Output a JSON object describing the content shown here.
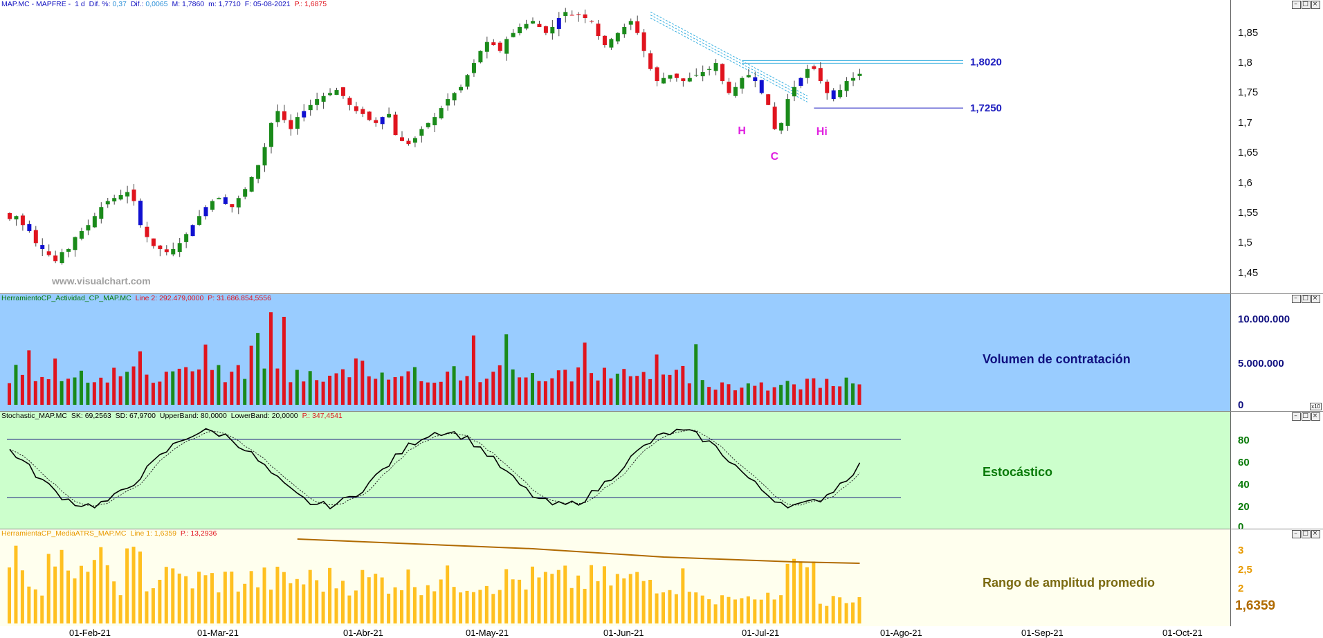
{
  "price_panel": {
    "header": {
      "symbol": "MAP.MC - MAPFRE -",
      "timeframe": "1 d",
      "dif_pct_label": "Dif. %:",
      "dif_pct_value": "0,37",
      "dif_label": "Dif.:",
      "dif_value": "0,0065",
      "max_label": "M: 1,7860",
      "min_label": "m: 1,7710",
      "date_label": "F: 05-08-2021",
      "p_label": "P.: 1,6875"
    },
    "watermark": "www.visualchart.com",
    "levels": [
      {
        "label": "1,8020",
        "value": 1.802
      },
      {
        "label": "1,7250",
        "value": 1.725
      }
    ],
    "pattern_labels": [
      "H",
      "C",
      "Hi"
    ],
    "yticks": [
      "1,85",
      "1,8",
      "1,75",
      "1,7",
      "1,65",
      "1,6",
      "1,55",
      "1,5",
      "1,45"
    ],
    "ytick_values": [
      1.85,
      1.8,
      1.75,
      1.7,
      1.65,
      1.6,
      1.55,
      1.5,
      1.45
    ],
    "colors": {
      "up": "#1a8a1a",
      "down": "#e0141e",
      "inside": "#1010d0",
      "trendline": "#3ab0e0",
      "level": "#2020c0"
    }
  },
  "volume_panel": {
    "header_name": "HerramientoCP_Actividad_CP_MAP.MC",
    "header_line": "Line 2: 292.479,0000",
    "header_p": "P: 31.686.854,5556",
    "title": "Volumen de contratación",
    "yticks": [
      "10.000.000",
      "5.000.000",
      "0"
    ],
    "scale_badge": "x10",
    "background": "#99ccff"
  },
  "stoch_panel": {
    "header_name": "Stochastic_MAP.MC",
    "header_sk": "SK: 69,2563",
    "header_sd": "SD: 67,9700",
    "header_upper": "UpperBand: 80,0000",
    "header_lower": "LowerBand: 20,0000",
    "header_p": "P.: 347,4541",
    "title": "Estocástico",
    "yticks": [
      "80",
      "60",
      "40",
      "20",
      "0"
    ],
    "background": "#ccffcc"
  },
  "atr_panel": {
    "header_name": "HerramientaCP_MediaATRS_MAP.MC",
    "header_line": "Line 1: 1,6359",
    "header_p": "P.: 13,2936",
    "title": "Rango de amplitud promedio",
    "yticks": [
      "3",
      "2,5",
      "2"
    ],
    "current_value": "1,6359",
    "background": "#ffffee"
  },
  "xaxis": {
    "labels": [
      "01-Feb-21",
      "01-Mar-21",
      "01-Abr-21",
      "01-May-21",
      "01-Jun-21",
      "01-Jul-21",
      "01-Ago-21",
      "01-Sep-21",
      "01-Oct-21"
    ]
  },
  "chart_data": {
    "type": "candlestick",
    "symbol": "MAP.MC",
    "closes": [
      1.54,
      1.545,
      1.53,
      1.52,
      1.5,
      1.49,
      1.48,
      1.47,
      1.485,
      1.49,
      1.51,
      1.52,
      1.53,
      1.545,
      1.56,
      1.57,
      1.575,
      1.58,
      1.585,
      1.57,
      1.53,
      1.51,
      1.495,
      1.49,
      1.485,
      1.49,
      1.5,
      1.515,
      1.53,
      1.545,
      1.56,
      1.57,
      1.575,
      1.565,
      1.56,
      1.575,
      1.59,
      1.61,
      1.63,
      1.66,
      1.7,
      1.72,
      1.705,
      1.69,
      1.71,
      1.72,
      1.73,
      1.74,
      1.745,
      1.75,
      1.755,
      1.745,
      1.73,
      1.72,
      1.715,
      1.705,
      1.7,
      1.71,
      1.715,
      1.68,
      1.67,
      1.665,
      1.675,
      1.69,
      1.7,
      1.71,
      1.725,
      1.74,
      1.75,
      1.76,
      1.78,
      1.8,
      1.82,
      1.835,
      1.83,
      1.82,
      1.84,
      1.85,
      1.86,
      1.865,
      1.87,
      1.86,
      1.85,
      1.86,
      1.875,
      1.885,
      1.88,
      1.88,
      1.875,
      1.87,
      1.845,
      1.83,
      1.84,
      1.85,
      1.86,
      1.87,
      1.85,
      1.82,
      1.79,
      1.77,
      1.775,
      1.78,
      1.775,
      1.77,
      1.775,
      1.78,
      1.785,
      1.79,
      1.8,
      1.77,
      1.75,
      1.76,
      1.775,
      1.78,
      1.77,
      1.75,
      1.73,
      1.69,
      1.7,
      1.74,
      1.76,
      1.775,
      1.79,
      1.79,
      1.77,
      1.75,
      1.74,
      1.755,
      1.77,
      1.775,
      1.782
    ]
  }
}
